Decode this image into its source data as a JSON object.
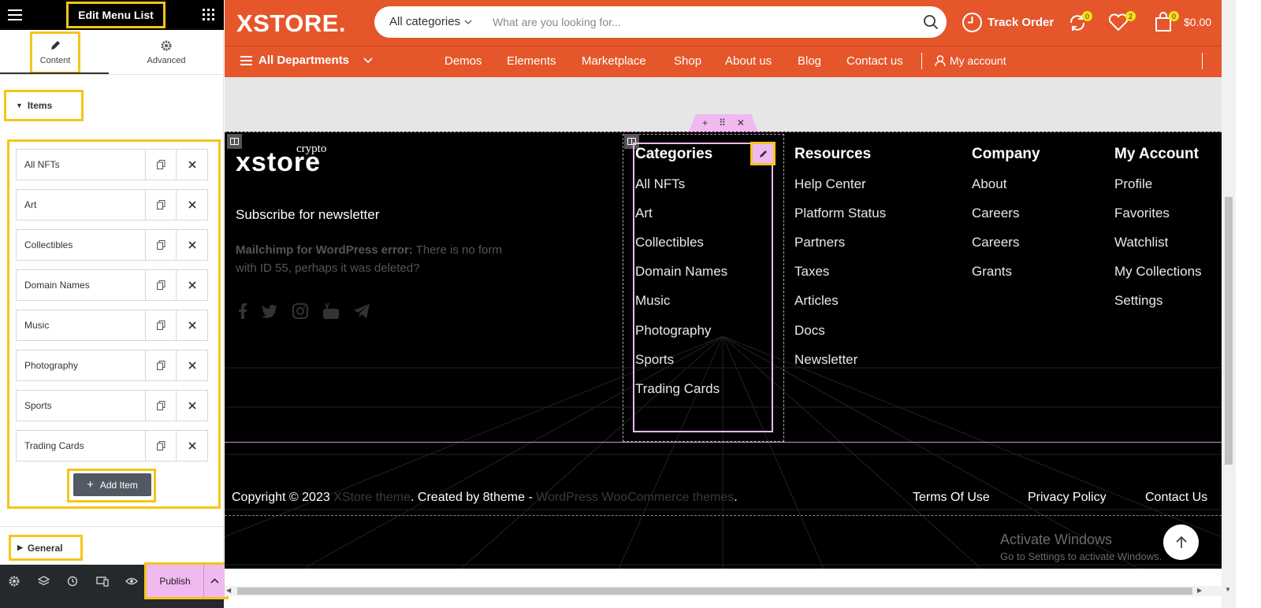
{
  "panel": {
    "title": "Edit Menu List",
    "tabs": [
      {
        "label": "Content"
      },
      {
        "label": "Advanced"
      }
    ],
    "items_section_label": "Items",
    "items": [
      {
        "label": "All NFTs"
      },
      {
        "label": "Art"
      },
      {
        "label": "Collectibles"
      },
      {
        "label": "Domain Names"
      },
      {
        "label": "Music"
      },
      {
        "label": "Photography"
      },
      {
        "label": "Sports"
      },
      {
        "label": "Trading Cards"
      }
    ],
    "add_item_label": "Add Item",
    "general_section_label": "General",
    "publish_label": "Publish"
  },
  "header": {
    "logo": "XSTORE.",
    "category_select": "All categories",
    "search_placeholder": "What are you looking for...",
    "track_order": "Track Order",
    "compare_count": "0",
    "wishlist_count": "2",
    "cart_count": "0",
    "cart_total": "$0.00",
    "departments": "All Departments",
    "nav": [
      "Demos",
      "Elements",
      "Marketplace",
      "Shop",
      "About us",
      "Blog",
      "Contact us"
    ],
    "my_account": "My account"
  },
  "footer": {
    "logo_main": "xstore",
    "logo_sup": "crypto",
    "subscribe_title": "Subscribe for newsletter",
    "error_bold": "Mailchimp for WordPress error:",
    "error_text": " There is no form with ID 55, perhaps it was deleted?",
    "columns": [
      {
        "title": "Categories",
        "links": [
          "All NFTs",
          "Art",
          "Collectibles",
          "Domain Names",
          "Music",
          "Photography",
          "Sports",
          "Trading Cards"
        ]
      },
      {
        "title": "Resources",
        "links": [
          "Help Center",
          "Platform Status",
          "Partners",
          "Taxes",
          "Articles",
          "Docs",
          "Newsletter"
        ]
      },
      {
        "title": "Company",
        "links": [
          "About",
          "Careers",
          "Careers",
          "Grants"
        ]
      },
      {
        "title": "My Account",
        "links": [
          "Profile",
          "Favorites",
          "Watchlist",
          "My Collections",
          "Settings"
        ]
      }
    ],
    "copyright_prefix": "Copyright © 2023 ",
    "copyright_link1": "XStore theme",
    "copyright_mid": ". Created by 8theme - ",
    "copyright_link2": "WordPress WooCommerce themes",
    "copyright_suffix": ".",
    "bottom_links": [
      "Terms Of Use",
      "Privacy Policy",
      "Contact Us"
    ],
    "activate_title": "Activate Windows",
    "activate_sub": "Go to Settings to activate Windows."
  },
  "colors": {
    "brand_orange": "#e5562a",
    "highlight_yellow": "#f5c518",
    "edit_pink": "#f0b9f0",
    "badge_yellow": "#f5e218"
  }
}
